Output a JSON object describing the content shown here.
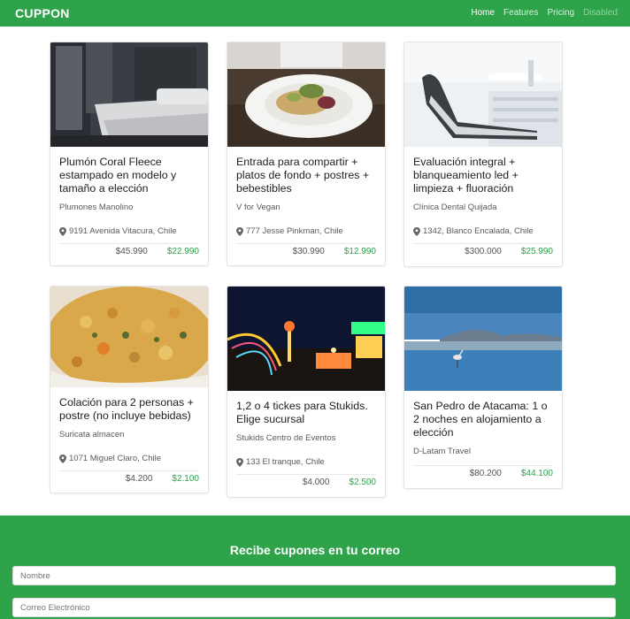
{
  "navbar": {
    "brand": "CUPPON",
    "links": [
      {
        "label": "Home",
        "state": "active"
      },
      {
        "label": "Features",
        "state": "normal"
      },
      {
        "label": "Pricing",
        "state": "normal"
      },
      {
        "label": "Disabled",
        "state": "disabled"
      }
    ]
  },
  "offers": [
    {
      "title": "Plumón Coral Fleece estampado en modelo y tamaño a elección",
      "company": "Plumones Manolino",
      "address": "9191 Avenida Vitacura, Chile",
      "price_old": "$45.990",
      "price_new": "$22.990",
      "image": "bedroom-photo"
    },
    {
      "title": "Entrada para compartir + platos de fondo + postres + bebestibles",
      "company": "V for Vegan",
      "address": "777 Jesse Pinkman, Chile",
      "price_old": "$30.990",
      "price_new": "$12.990",
      "image": "salad-plate-photo"
    },
    {
      "title": "Evaluación integral + blanqueamiento led + limpieza + fluoración",
      "company": "Clínica Dental Quijada",
      "address": "1342, Blanco Encalada, Chile",
      "price_old": "$300.000",
      "price_new": "$25.990",
      "image": "dental-chair-photo"
    },
    {
      "title": "Colación para 2 personas + postre (no incluye bebidas)",
      "company": "Suricata almacen",
      "address": "1071 Miguel Claro, Chile",
      "price_old": "$4.200",
      "price_new": "$2.100",
      "image": "food-dish-photo"
    },
    {
      "title": "1,2 o 4 tickes para Stukids. Elige sucursal",
      "company": "Stukids Centro de Eventos",
      "address": "133 El tranque, Chile",
      "price_old": "$4.000",
      "price_new": "$2.500",
      "image": "amusement-park-photo"
    },
    {
      "title": "San Pedro de Atacama: 1 o 2 noches en alojamiento a elección",
      "company": "D-Latam Travel",
      "address": "",
      "price_old": "$80.200",
      "price_new": "$44.100",
      "image": "lagoon-flamingo-photo"
    }
  ],
  "subscribe": {
    "title": "Recibe cupones en tu correo",
    "name_placeholder": "Nombre",
    "email_placeholder": "Correo Electrónico"
  },
  "colors": {
    "brand_green": "#2ea34a",
    "price_green": "#2ea34a"
  }
}
